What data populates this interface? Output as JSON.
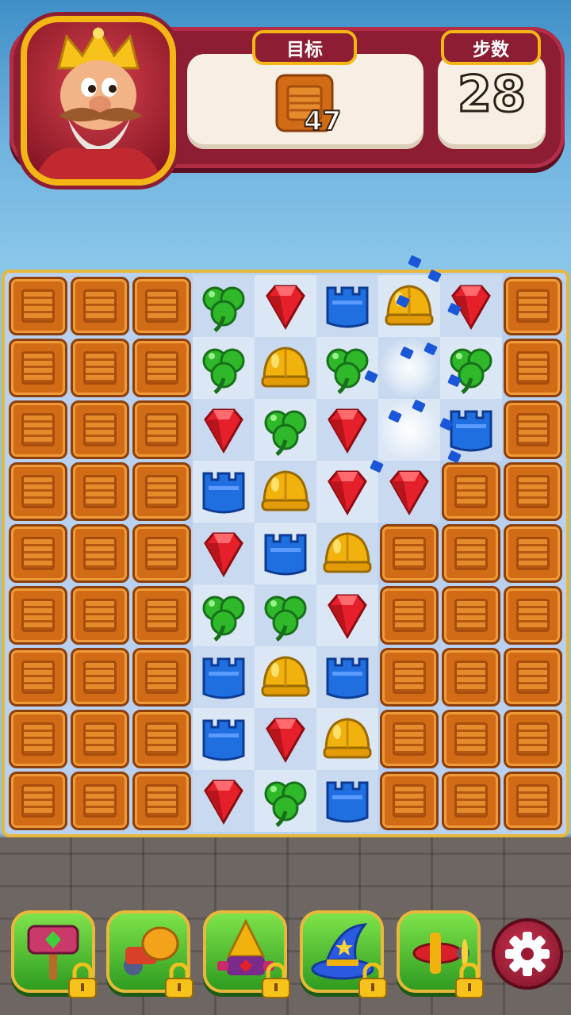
{
  "header": {
    "goal_label": "目标",
    "goal_icon": "wooden-crate",
    "goal_count": "47",
    "moves_label": "步数",
    "moves_value": "28",
    "avatar": "king-character"
  },
  "board": {
    "rows": 9,
    "cols": 9,
    "grid": [
      [
        "crate",
        "crate",
        "crate",
        "clover",
        "ruby",
        "tower",
        "helmet",
        "ruby",
        "crate"
      ],
      [
        "crate",
        "crate",
        "crate",
        "clover",
        "helmet",
        "clover",
        "empty",
        "clover",
        "crate"
      ],
      [
        "crate",
        "crate",
        "crate",
        "ruby",
        "clover",
        "ruby",
        "empty",
        "tower",
        "crate"
      ],
      [
        "crate",
        "crate",
        "crate",
        "tower",
        "helmet",
        "ruby",
        "ruby",
        "crate",
        "crate"
      ],
      [
        "crate",
        "crate",
        "crate",
        "ruby",
        "tower",
        "helmet",
        "crate",
        "crate",
        "crate"
      ],
      [
        "crate",
        "crate",
        "crate",
        "clover",
        "clover",
        "ruby",
        "crate",
        "crate",
        "crate"
      ],
      [
        "crate",
        "crate",
        "crate",
        "tower",
        "helmet",
        "tower",
        "crate",
        "crate",
        "crate"
      ],
      [
        "crate",
        "crate",
        "crate",
        "tower",
        "ruby",
        "helmet",
        "crate",
        "crate",
        "crate"
      ],
      [
        "crate",
        "crate",
        "crate",
        "ruby",
        "clover",
        "tower",
        "crate",
        "crate",
        "crate"
      ]
    ],
    "colors": {
      "ruby": "#e5202a",
      "clover": "#2fb82a",
      "tower": "#1f6fe0",
      "helmet": "#f2b20e",
      "crate": "#d26b16"
    }
  },
  "boosters": [
    {
      "name": "hammer",
      "locked": true
    },
    {
      "name": "boxing-glove-cannon",
      "locked": true
    },
    {
      "name": "drill-rocket",
      "locked": true
    },
    {
      "name": "wizard-hat",
      "locked": true
    },
    {
      "name": "airplane",
      "locked": true
    }
  ],
  "settings_icon": "gear-icon"
}
